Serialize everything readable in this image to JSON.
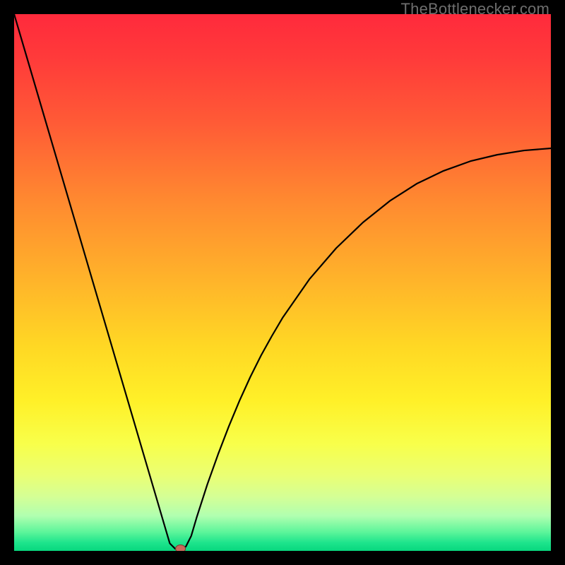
{
  "watermark": "TheBottlenecker.com",
  "chart_data": {
    "type": "line",
    "title": "",
    "xlabel": "",
    "ylabel": "",
    "xlim": [
      0,
      100
    ],
    "ylim": [
      0,
      100
    ],
    "series": [
      {
        "name": "bottleneck-curve",
        "x": [
          0,
          2,
          4,
          6,
          8,
          10,
          12,
          14,
          16,
          18,
          20,
          22,
          24,
          26,
          28,
          29,
          30,
          31,
          32,
          33,
          34,
          36,
          38,
          40,
          42,
          44,
          46,
          48,
          50,
          55,
          60,
          65,
          70,
          75,
          80,
          85,
          90,
          95,
          100
        ],
        "y": [
          100,
          93.2,
          86.4,
          79.6,
          72.8,
          66.0,
          59.2,
          52.4,
          45.6,
          38.8,
          32.0,
          25.2,
          18.4,
          11.6,
          4.8,
          1.4,
          0.4,
          0.4,
          0.8,
          2.8,
          6.2,
          12.4,
          18.0,
          23.2,
          28.0,
          32.4,
          36.4,
          40.0,
          43.4,
          50.6,
          56.4,
          61.2,
          65.2,
          68.4,
          70.8,
          72.6,
          73.8,
          74.6,
          75.0
        ]
      }
    ],
    "marker": {
      "x": 31,
      "y": 0.4
    },
    "gradient_stops": [
      {
        "offset": 0.0,
        "color": "#ff2a3c"
      },
      {
        "offset": 0.08,
        "color": "#ff3a3a"
      },
      {
        "offset": 0.2,
        "color": "#ff5a36"
      },
      {
        "offset": 0.35,
        "color": "#ff8a30"
      },
      {
        "offset": 0.5,
        "color": "#ffb52a"
      },
      {
        "offset": 0.62,
        "color": "#ffd824"
      },
      {
        "offset": 0.72,
        "color": "#fff028"
      },
      {
        "offset": 0.8,
        "color": "#f8ff4a"
      },
      {
        "offset": 0.86,
        "color": "#eaff74"
      },
      {
        "offset": 0.9,
        "color": "#d4ff96"
      },
      {
        "offset": 0.935,
        "color": "#b0ffb0"
      },
      {
        "offset": 0.965,
        "color": "#5cf59a"
      },
      {
        "offset": 0.985,
        "color": "#1de48c"
      },
      {
        "offset": 1.0,
        "color": "#08d77e"
      }
    ],
    "curve_color": "#000000",
    "curve_width": 2.2,
    "marker_fill": "#c96a5a",
    "marker_stroke": "#7a3a30"
  }
}
